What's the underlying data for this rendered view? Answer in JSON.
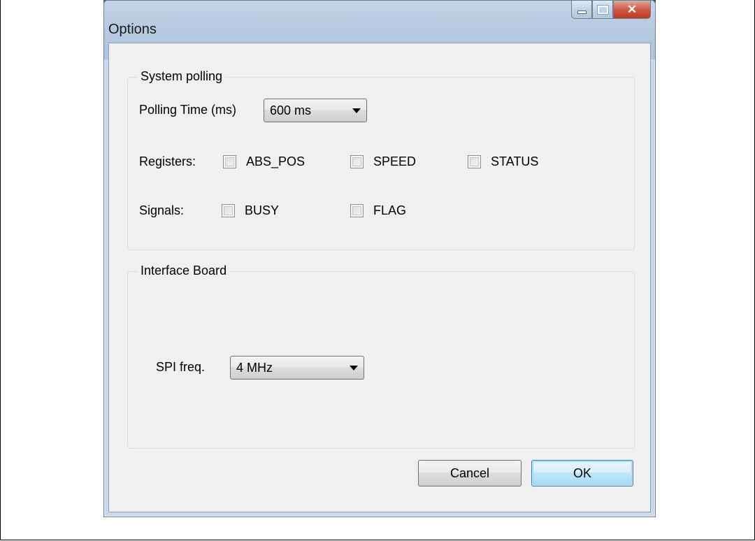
{
  "window": {
    "title": "Options"
  },
  "system_polling": {
    "group_label": "System polling",
    "polling_time_label": "Polling Time (ms)",
    "polling_time_value": "600 ms",
    "registers_label": "Registers:",
    "registers": [
      {
        "label": "ABS_POS",
        "checked": false
      },
      {
        "label": "SPEED",
        "checked": false
      },
      {
        "label": "STATUS",
        "checked": false
      }
    ],
    "signals_label": "Signals:",
    "signals": [
      {
        "label": "BUSY",
        "checked": false
      },
      {
        "label": "FLAG",
        "checked": false
      }
    ]
  },
  "interface_board": {
    "group_label": "Interface Board",
    "spi_freq_label": "SPI freq.",
    "spi_freq_value": "4 MHz"
  },
  "buttons": {
    "cancel": "Cancel",
    "ok": "OK"
  },
  "icons": {
    "minimize": "minimize-icon",
    "maximize": "maximize-icon",
    "close": "close-icon",
    "dropdown": "chevron-down-icon"
  }
}
